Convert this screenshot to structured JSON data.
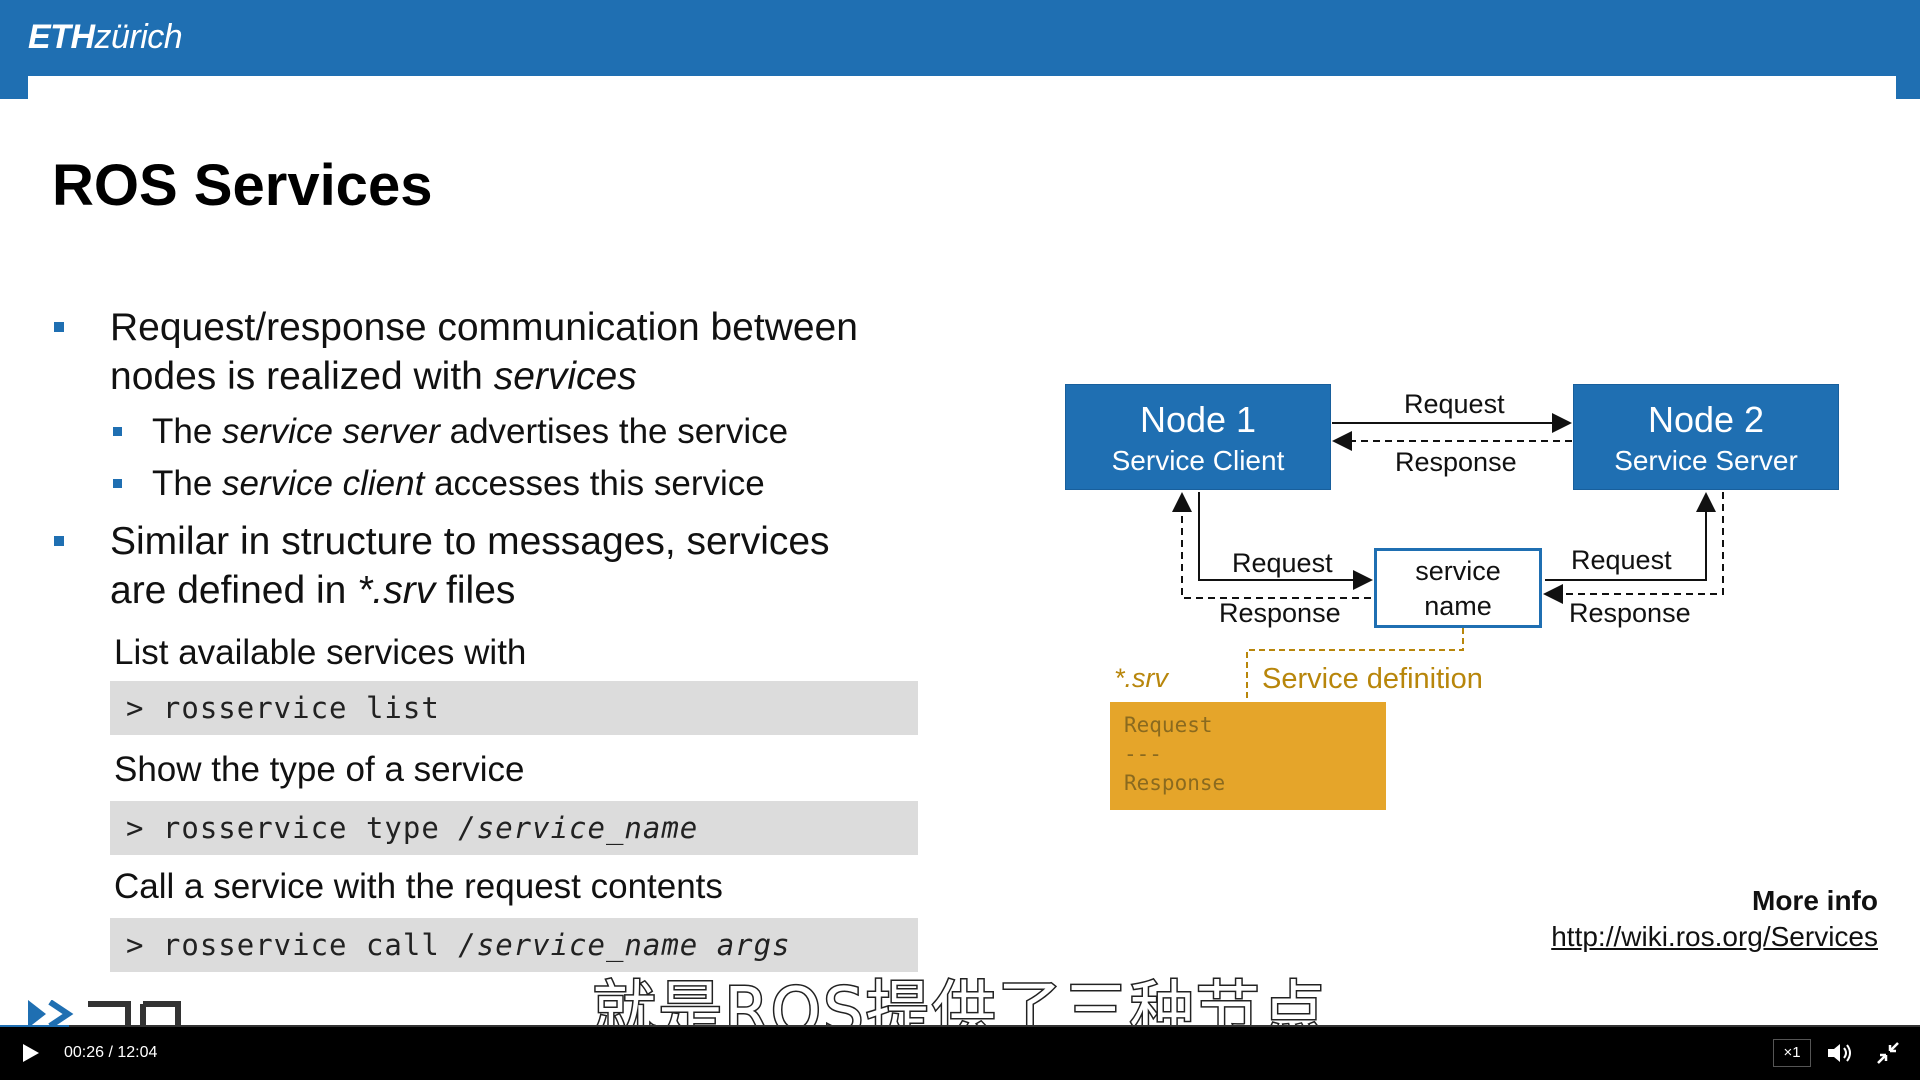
{
  "header": {
    "logo_eth": "ETH",
    "logo_zurich": "zürich"
  },
  "slide": {
    "title": "ROS Services",
    "bullets": [
      {
        "line1": "Request/response communication between",
        "line2_pre": "nodes is realized with ",
        "line2_em": "services"
      },
      {
        "sub1_pre": "The ",
        "sub1_em": "service server",
        "sub1_post": " advertises the service"
      },
      {
        "sub2_pre": "The ",
        "sub2_em": "service client",
        "sub2_post": " accesses this service"
      },
      {
        "line1": "Similar in structure to messages, services",
        "line2_pre": "are defined in ",
        "line2_em": "*.srv",
        "line2_post": " files"
      }
    ],
    "commands": [
      {
        "caption": "List available services with",
        "prompt": "> ",
        "cmd": "rosservice list",
        "arg": ""
      },
      {
        "caption": "Show the type of a service",
        "prompt": "> ",
        "cmd": "rosservice type ",
        "arg": "/service_name"
      },
      {
        "caption": "Call a service with the request contents",
        "prompt": "> ",
        "cmd": "rosservice call ",
        "arg": "/service_name args"
      }
    ],
    "more_info_label": "More info",
    "more_info_link": "http://wiki.ros.org/Services"
  },
  "diagram": {
    "node1": {
      "title": "Node 1",
      "role": "Service Client"
    },
    "node2": {
      "title": "Node 2",
      "role": "Service Server"
    },
    "top_request": "Request",
    "top_response": "Response",
    "left_request": "Request",
    "left_response": "Response",
    "right_request": "Request",
    "right_response": "Response",
    "service_name_line1": "service",
    "service_name_line2": "name",
    "srv_label": "*.srv",
    "service_definition": "Service definition",
    "srv_lines": [
      "Request",
      "---",
      "Response"
    ]
  },
  "subtitle": "就是ROS提供了三种节点",
  "player": {
    "time": "00:26 / 12:04",
    "speed": "×1",
    "progress_fraction": 0.036,
    "accent_color": "#1f6fb2"
  }
}
